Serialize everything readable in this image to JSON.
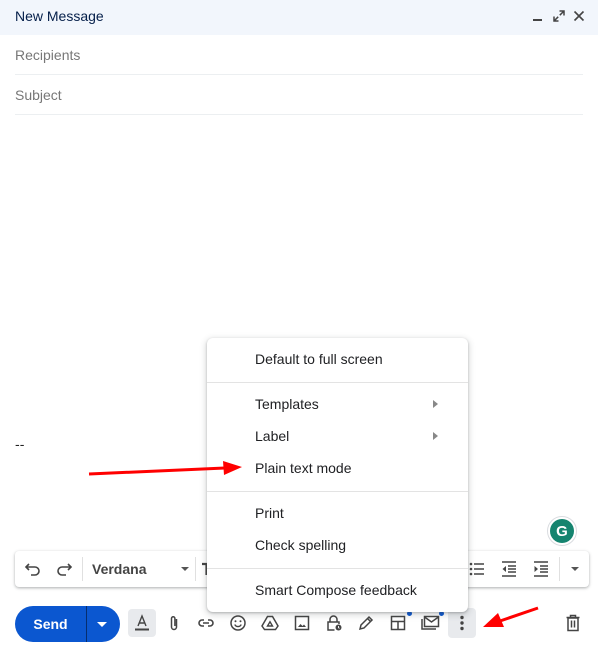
{
  "window": {
    "title": "New Message",
    "controls": {
      "minimize": "minimize-icon",
      "fullscreen": "expand-icon",
      "close": "close-icon"
    }
  },
  "fields": {
    "recipients": {
      "placeholder": "Recipients",
      "value": ""
    },
    "subject": {
      "placeholder": "Subject",
      "value": ""
    }
  },
  "body": {
    "signature": "--"
  },
  "format_toolbar": {
    "undo": "undo-icon",
    "redo": "redo-icon",
    "font": "Verdana",
    "items_right": [
      "bulleted-list-icon",
      "indent-less-icon",
      "indent-more-icon",
      "more-formatting-icon"
    ]
  },
  "grammarly": {
    "letter": "G",
    "color": "#15846f"
  },
  "bottom_toolbar": {
    "send_label": "Send",
    "icons": [
      "formatting-options-icon",
      "attach-file-icon",
      "insert-link-icon",
      "insert-emoji-icon",
      "google-drive-icon",
      "insert-photo-icon",
      "confidential-mode-icon",
      "signature-icon",
      "layouts-icon",
      "schedule-email-icon",
      "more-options-icon",
      "discard-draft-icon"
    ]
  },
  "more_options_menu": {
    "sections": [
      {
        "items": [
          {
            "label": "Default to full screen",
            "submenu": false
          }
        ]
      },
      {
        "items": [
          {
            "label": "Templates",
            "submenu": true
          },
          {
            "label": "Label",
            "submenu": true
          },
          {
            "label": "Plain text mode",
            "submenu": false
          }
        ]
      },
      {
        "items": [
          {
            "label": "Print",
            "submenu": false
          },
          {
            "label": "Check spelling",
            "submenu": false
          }
        ]
      },
      {
        "items": [
          {
            "label": "Smart Compose feedback",
            "submenu": false
          }
        ]
      }
    ]
  },
  "colors": {
    "accent": "#0b57d0",
    "header_bg": "#f2f6fc",
    "annotation_arrow": "#ff0000"
  }
}
